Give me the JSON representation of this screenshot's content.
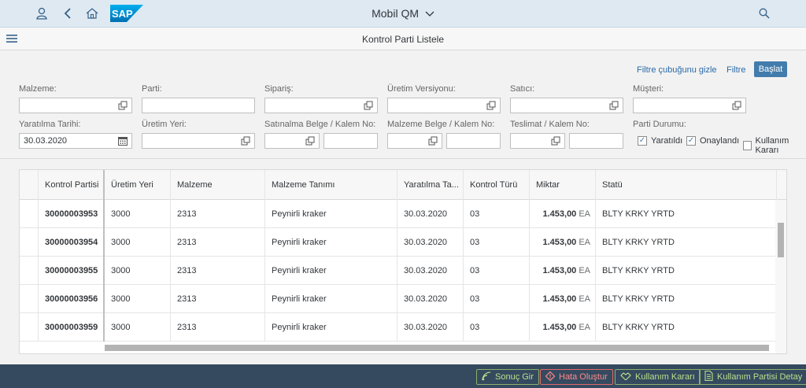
{
  "shell": {
    "app_title": "Mobil QM",
    "logo_text": "SAP"
  },
  "page": {
    "title": "Kontrol Parti Listele"
  },
  "filter_bar": {
    "hide_label": "Filtre çubuğunu gizle",
    "filter_label": "Filtre",
    "go_label": "Başlat",
    "fields": {
      "malzeme": {
        "label": "Malzeme:",
        "value": ""
      },
      "parti": {
        "label": "Parti:",
        "value": ""
      },
      "siparis": {
        "label": "Sipariş:",
        "value": ""
      },
      "uretim_versiyonu": {
        "label": "Üretim Versiyonu:",
        "value": ""
      },
      "satici": {
        "label": "Satıcı:",
        "value": ""
      },
      "musteri": {
        "label": "Müşteri:",
        "value": ""
      },
      "yaratilma_tarihi": {
        "label": "Yaratılma Tarihi:",
        "value": "30.03.2020"
      },
      "uretim_yeri": {
        "label": "Üretim Yeri:",
        "value": ""
      },
      "satinalma_belge": {
        "label": "Satınalma Belge / Kalem No:",
        "value": ""
      },
      "malzeme_belge": {
        "label": "Malzeme Belge / Kalem No:",
        "value": ""
      },
      "teslimat": {
        "label": "Teslimat / Kalem No:",
        "value": ""
      },
      "parti_durumu": {
        "label": "Parti Durumu:"
      }
    },
    "status_checks": [
      {
        "label": "Yaratıldı",
        "checked": true
      },
      {
        "label": "Onaylandı",
        "checked": true
      },
      {
        "label": "Kullanım Kararı",
        "checked": false
      }
    ]
  },
  "table": {
    "columns": [
      "Kontrol Partisi",
      "Üretim Yeri",
      "Malzeme",
      "Malzeme Tanımı",
      "Yaratılma Ta...",
      "Kontrol Türü",
      "Miktar",
      "Statü"
    ],
    "rows": [
      {
        "lot": "30000003953",
        "plant": "3000",
        "material": "2313",
        "desc": "Peynirli kraker",
        "date": "30.03.2020",
        "type": "03",
        "qty": "1.453,00",
        "unit": "EA",
        "status": "BLTY KRKY YRTD"
      },
      {
        "lot": "30000003954",
        "plant": "3000",
        "material": "2313",
        "desc": "Peynirli kraker",
        "date": "30.03.2020",
        "type": "03",
        "qty": "1.453,00",
        "unit": "EA",
        "status": "BLTY KRKY YRTD"
      },
      {
        "lot": "30000003955",
        "plant": "3000",
        "material": "2313",
        "desc": "Peynirli kraker",
        "date": "30.03.2020",
        "type": "03",
        "qty": "1.453,00",
        "unit": "EA",
        "status": "BLTY KRKY YRTD"
      },
      {
        "lot": "30000003956",
        "plant": "3000",
        "material": "2313",
        "desc": "Peynirli kraker",
        "date": "30.03.2020",
        "type": "03",
        "qty": "1.453,00",
        "unit": "EA",
        "status": "BLTY KRKY YRTD"
      },
      {
        "lot": "30000003959",
        "plant": "3000",
        "material": "2313",
        "desc": "Peynirli kraker",
        "date": "30.03.2020",
        "type": "03",
        "qty": "1.453,00",
        "unit": "EA",
        "status": "BLTY KRKY YRTD"
      }
    ]
  },
  "footer": {
    "buttons": [
      {
        "label": "Sonuç Gir",
        "icon": "signal-icon"
      },
      {
        "label": "Hata Oluştur",
        "icon": "diamond-alert-icon"
      },
      {
        "label": "Kullanım Kararı",
        "icon": "handshake-icon"
      },
      {
        "label": "Kullanım Partisi Detay",
        "icon": "document-detail-icon"
      }
    ]
  },
  "colors": {
    "shell_bg": "#dfe9f2",
    "accent": "#427cac",
    "footer_bg": "#354a5f",
    "footer_green": "#b8e08a",
    "footer_red": "#ff8a8a"
  }
}
